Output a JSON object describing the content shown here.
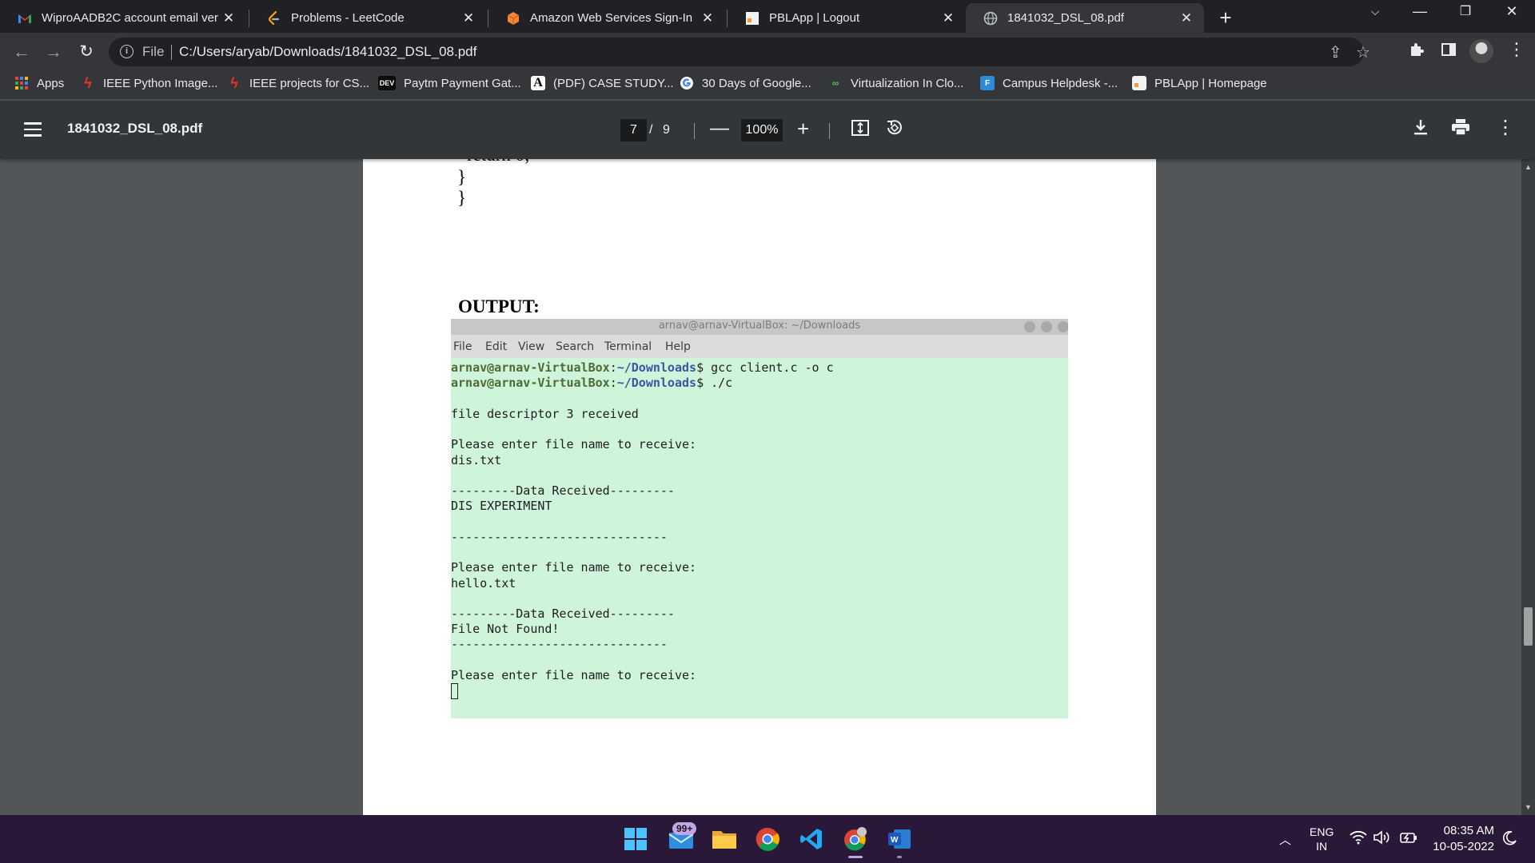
{
  "browser": {
    "tabs": [
      {
        "title": "WiproAADB2C account email ver",
        "active": false
      },
      {
        "title": "Problems - LeetCode",
        "active": false
      },
      {
        "title": "Amazon Web Services Sign-In",
        "active": false
      },
      {
        "title": "PBLApp | Logout",
        "active": false
      },
      {
        "title": "1841032_DSL_08.pdf",
        "active": true
      }
    ],
    "address": {
      "scheme_label": "File",
      "url": "C:/Users/aryab/Downloads/1841032_DSL_08.pdf"
    },
    "bookmarks": [
      {
        "label": "Apps",
        "icon": "apps-grid-icon"
      },
      {
        "label": "IEEE Python Image...",
        "icon": "ieee-red-icon"
      },
      {
        "label": "IEEE projects for CS...",
        "icon": "ieee-red-icon"
      },
      {
        "label": "Paytm Payment Gat...",
        "icon": "dev-icon"
      },
      {
        "label": "(PDF) CASE STUDY...",
        "icon": "academia-icon"
      },
      {
        "label": "30 Days of Google...",
        "icon": "google-icon"
      },
      {
        "label": "Virtualization In Clo...",
        "icon": "link-icon"
      },
      {
        "label": "Campus Helpdesk -...",
        "icon": "helpdesk-icon"
      },
      {
        "label": "PBLApp | Homepage",
        "icon": "pblapp-icon"
      }
    ]
  },
  "pdf_viewer": {
    "title": "1841032_DSL_08.pdf",
    "current_page": "7",
    "page_separator": "/",
    "total_pages": "9",
    "zoom": "100%"
  },
  "document": {
    "code_tail": [
      "return 0;",
      "}",
      "}"
    ],
    "output_heading": "OUTPUT:",
    "terminal": {
      "title": "arnav@arnav-VirtualBox: ~/Downloads",
      "menu": [
        "File",
        "Edit",
        "View",
        "Search",
        "Terminal",
        "Help"
      ],
      "prompt_user": "arnav@arnav-VirtualBox",
      "prompt_path": "~/Downloads",
      "commands": [
        "$ gcc client.c -o c",
        "$ ./c"
      ],
      "lines": [
        "file descriptor 3 received",
        "Please enter file name to receive:",
        "dis.txt",
        "---------Data Received---------",
        "DIS EXPERIMENT",
        "------------------------------",
        "Please enter file name to receive:",
        "hello.txt",
        "---------Data Received---------",
        "File Not Found!",
        "------------------------------",
        "Please enter file name to receive:"
      ]
    }
  },
  "taskbar": {
    "mail_badge": "99+",
    "lang_primary": "ENG",
    "lang_secondary": "IN",
    "time": "08:35 AM",
    "date": "10-05-2022"
  },
  "colors": {
    "terminal_bg": "#cef4da",
    "prompt_green": "#4e6b35",
    "path_blue": "#3b56a4",
    "taskbar_bg": "#2a1838"
  }
}
